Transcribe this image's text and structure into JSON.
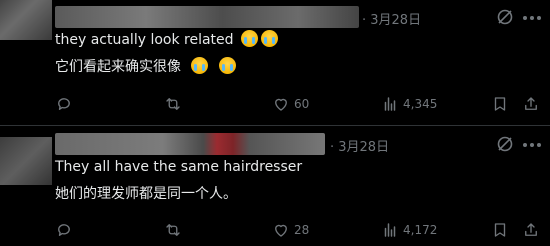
{
  "posts": [
    {
      "date": "· 3月28日",
      "line1": "they actually look related",
      "line2": "它们看起来确实很像",
      "line1_emoji_count": 2,
      "line2_emoji_count": 2,
      "likes": "60",
      "views": "4,345"
    },
    {
      "date": "· 3月28日",
      "line1": "They all have the same hairdresser",
      "line2": "她们的理发师都是同一个人。",
      "line1_emoji_count": 0,
      "line2_emoji_count": 0,
      "likes": "28",
      "views": "4,172"
    }
  ],
  "icons": {
    "reply": "reply-icon",
    "retweet": "retweet-icon",
    "like": "heart-icon",
    "views": "views-chart-icon",
    "bookmark": "bookmark-icon",
    "share": "share-icon",
    "grok": "grok-icon",
    "more": "more-icon",
    "emoji": "loudly-crying-face-emoji"
  },
  "colors": {
    "background": "#000000",
    "text": "#e7e9ea",
    "muted": "#71767b",
    "divider": "#2f3336"
  }
}
